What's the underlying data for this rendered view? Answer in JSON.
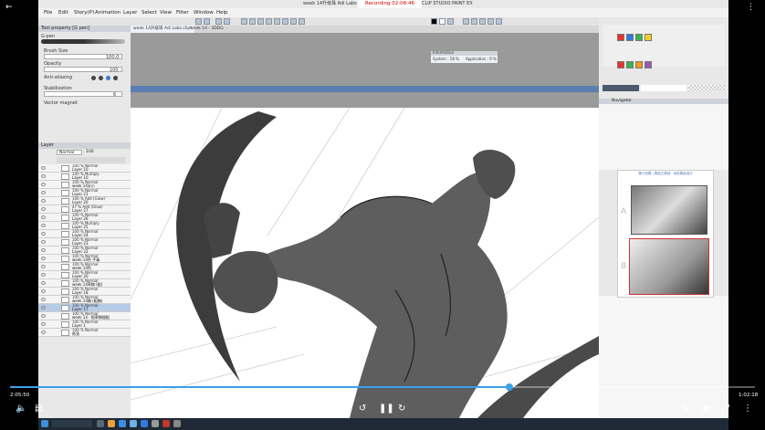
{
  "window": {
    "title": "week 14升级珠 Adi Labs",
    "app_name": "CLIP STUDIO PAINT EX",
    "recording_label": "Recording 02:08:46"
  },
  "menu": [
    "File",
    "Edit",
    "Story(P)",
    "Animation",
    "Layer",
    "Select",
    "View",
    "Filter",
    "Window",
    "Help"
  ],
  "tool_property": {
    "tab": "Tool property [G pen]",
    "tool": "G-pen",
    "brush_size_label": "Brush Size",
    "brush_size_value": "100.0",
    "opacity_label": "Opacity",
    "opacity_value": "100",
    "antialias_label": "Anti-aliasing",
    "stabilization_label": "Stabilization",
    "stabilization_value": "6",
    "vector_magnet_label": "Vector magnet"
  },
  "layer_panel": {
    "title": "Layer",
    "blend_mode": "Normal",
    "opacity": "100",
    "layers": [
      {
        "mode": "100 % Normal",
        "name": "Layer 10"
      },
      {
        "mode": "100 % Multiply",
        "name": "Layer 10"
      },
      {
        "mode": "100 % Normal",
        "name": "week 14水小"
      },
      {
        "mode": "100 % Normal",
        "name": "Layer 21"
      },
      {
        "mode": "100 % Add (Glow)",
        "name": "Layer 20"
      },
      {
        "mode": "47 % Add (Glow)",
        "name": "Layer 27"
      },
      {
        "mode": "100 % Normal",
        "name": "Layer 26"
      },
      {
        "mode": "100 % Multiply",
        "name": "Layer 25"
      },
      {
        "mode": "100 % Normal",
        "name": "Layer 24"
      },
      {
        "mode": "100 % Normal",
        "name": "Layer 23"
      },
      {
        "mode": "100 % Normal",
        "name": "Layer 22"
      },
      {
        "mode": "100 % Normal",
        "name": "week 14色 手毒"
      },
      {
        "mode": "100 % Normal",
        "name": "week 14色"
      },
      {
        "mode": "100 % Normal",
        "name": "Layer 20"
      },
      {
        "mode": "100 % Normal",
        "name": "week 14草稿 (粗)"
      },
      {
        "mode": "100 % Normal",
        "name": "Layer 18"
      },
      {
        "mode": "100 % Normal",
        "name": "week 14稿 (粗稿)"
      },
      {
        "mode": "100 % Normal",
        "name": "Layer 17"
      },
      {
        "mode": "100 % Normal",
        "name": "week 14 - 粗草稿描粗"
      },
      {
        "mode": "100 % Normal",
        "name": "Layer 1"
      },
      {
        "mode": "100 % Normal",
        "name": "纸张"
      }
    ],
    "selected_index": 17
  },
  "document_tabs": [
    "week 14升级珠 Adi Labs.clip*",
    "week 14 - 3DDG"
  ],
  "info_popup": {
    "title": "Information",
    "system": "System : 28 %",
    "application": "Application : 9 %"
  },
  "navigator": {
    "title": "Navigator",
    "ref_header": "第十四周 | 角色之原创 · 动态角色设计",
    "label_a": "A",
    "label_b": "B"
  },
  "player": {
    "elapsed": "2:05:50",
    "total": "1:02:18",
    "progress_fraction": 0.67
  },
  "colors": {
    "canvas_band": "#5b7fb3",
    "progress": "#3aa0e8",
    "swatch_colors": [
      "#e6332a",
      "#2d7be0",
      "#38b54a",
      "#f3d21e",
      "#1a1a1a",
      "#ffffff",
      "#9b59b6",
      "#f39c12"
    ]
  },
  "icons": [
    "play-icon",
    "volume-icon",
    "subtitle-icon",
    "rewind-10-icon",
    "pause-icon",
    "forward-10-icon",
    "pen-icon",
    "display-icon",
    "fullscreen-icon",
    "more-icon"
  ]
}
